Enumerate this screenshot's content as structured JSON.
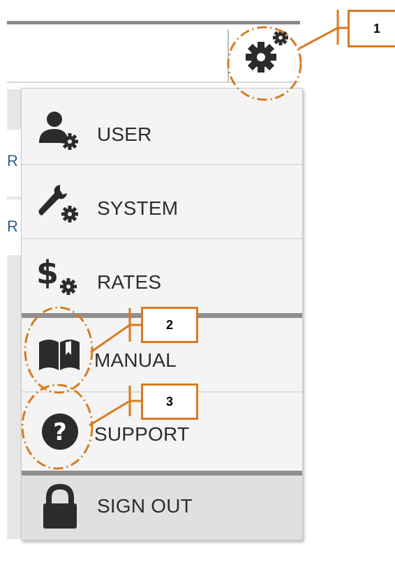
{
  "menu": {
    "items": [
      {
        "label": "USER",
        "icon": "user-gear-icon"
      },
      {
        "label": "SYSTEM",
        "icon": "wrench-gear-icon"
      },
      {
        "label": "RATES",
        "icon": "dollar-gear-icon"
      },
      {
        "label": "MANUAL",
        "icon": "book-icon"
      },
      {
        "label": "SUPPORT",
        "icon": "help-circle-icon"
      },
      {
        "label": "SIGN OUT",
        "icon": "lock-icon"
      }
    ]
  },
  "background": {
    "row_fragments": [
      "R",
      "R"
    ]
  },
  "callouts": [
    "1",
    "2",
    "3"
  ],
  "colors": {
    "callout": "#d97a1e",
    "icon": "#2b2b2b",
    "link_text": "#2c5e8e"
  }
}
